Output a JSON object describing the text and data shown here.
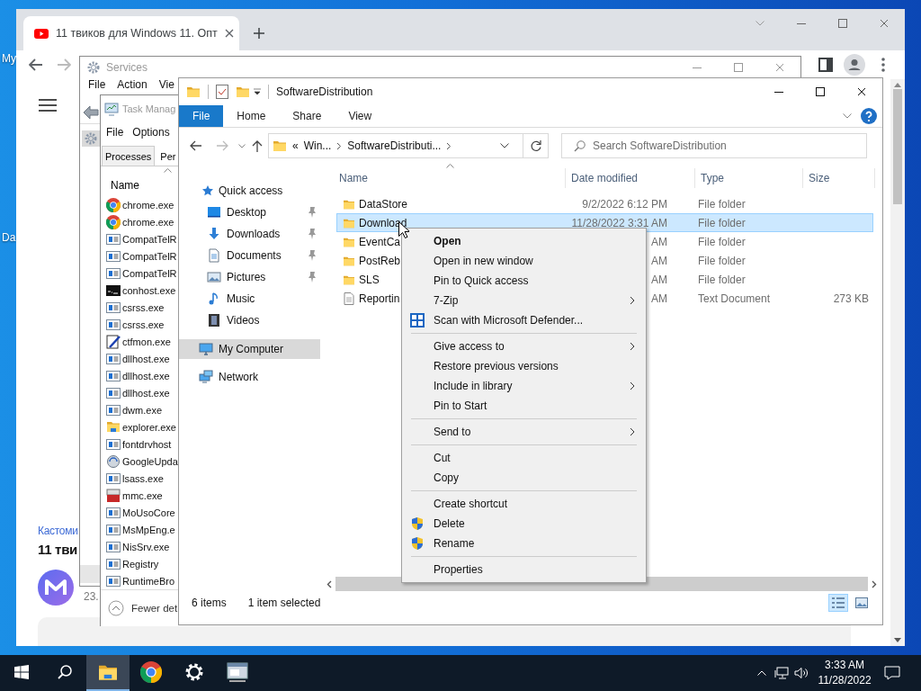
{
  "desktop": {
    "icon_labels": [
      "My",
      "Da"
    ]
  },
  "browser": {
    "tab_title": "11 твиков для Windows 11. Опт",
    "page": {
      "category": "Кастоми",
      "heading": "11 тви",
      "date": "23."
    }
  },
  "services": {
    "title": "Services",
    "menu": [
      "File",
      "Action",
      "Vie"
    ]
  },
  "task_manager": {
    "title": "Task Manag",
    "menu": [
      "File",
      "Options"
    ],
    "tabs": [
      {
        "label": "Processes",
        "selected": true
      },
      {
        "label": "Per",
        "selected": false
      }
    ],
    "column": "Name",
    "processes": [
      {
        "name": "chrome.exe",
        "kind": "chrome"
      },
      {
        "name": "chrome.exe",
        "kind": "chrome"
      },
      {
        "name": "CompatTelR",
        "kind": "app"
      },
      {
        "name": "CompatTelR",
        "kind": "app"
      },
      {
        "name": "CompatTelR",
        "kind": "app"
      },
      {
        "name": "conhost.exe",
        "kind": "console"
      },
      {
        "name": "csrss.exe",
        "kind": "app"
      },
      {
        "name": "csrss.exe",
        "kind": "app"
      },
      {
        "name": "ctfmon.exe",
        "kind": "pen"
      },
      {
        "name": "dllhost.exe",
        "kind": "app"
      },
      {
        "name": "dllhost.exe",
        "kind": "app"
      },
      {
        "name": "dllhost.exe",
        "kind": "app"
      },
      {
        "name": "dwm.exe",
        "kind": "app"
      },
      {
        "name": "explorer.exe",
        "kind": "explorer"
      },
      {
        "name": "fontdrvhost",
        "kind": "app"
      },
      {
        "name": "GoogleUpda",
        "kind": "update"
      },
      {
        "name": "lsass.exe",
        "kind": "app"
      },
      {
        "name": "mmc.exe",
        "kind": "toolbox"
      },
      {
        "name": "MoUsoCore",
        "kind": "app"
      },
      {
        "name": "MsMpEng.e",
        "kind": "app"
      },
      {
        "name": "NisSrv.exe",
        "kind": "app"
      },
      {
        "name": "Registry",
        "kind": "app"
      },
      {
        "name": "RuntimeBro",
        "kind": "app"
      }
    ],
    "footer": "Fewer det"
  },
  "explorer": {
    "title": "SoftwareDistribution",
    "ribbon_tabs": [
      {
        "label": "File",
        "selected": true
      },
      {
        "label": "Home",
        "selected": false
      },
      {
        "label": "Share",
        "selected": false
      },
      {
        "label": "View",
        "selected": false
      }
    ],
    "path_overflow": "«",
    "path": [
      "Win...",
      "SoftwareDistributi..."
    ],
    "search_placeholder": "Search SoftwareDistribution",
    "nav": [
      {
        "label": "Quick access",
        "kind": "star",
        "selected": false,
        "children": [
          {
            "label": "Desktop",
            "kind": "desktop",
            "pinned": true,
            "selected": false
          },
          {
            "label": "Downloads",
            "kind": "downloads",
            "pinned": true,
            "selected": false
          },
          {
            "label": "Documents",
            "kind": "documents",
            "pinned": true,
            "selected": false
          },
          {
            "label": "Pictures",
            "kind": "pictures",
            "pinned": true,
            "selected": false
          },
          {
            "label": "Music",
            "kind": "music",
            "pinned": false,
            "selected": false
          },
          {
            "label": "Videos",
            "kind": "videos",
            "pinned": false,
            "selected": false
          }
        ]
      },
      {
        "label": "My Computer",
        "kind": "computer",
        "selected": true
      },
      {
        "label": "Network",
        "kind": "network",
        "selected": false
      }
    ],
    "columns": [
      "Name",
      "Date modified",
      "Type",
      "Size"
    ],
    "files": [
      {
        "name": "DataStore",
        "date": "9/2/2022 6:12 PM",
        "type": "File folder",
        "kind": "folder",
        "selected": false
      },
      {
        "name": "Download",
        "date": "11/28/2022 3:31 AM",
        "type": "File folder",
        "kind": "folder",
        "selected": true
      },
      {
        "name": "EventCa",
        "date": "AM",
        "type": "File folder",
        "kind": "folder",
        "selected": false
      },
      {
        "name": "PostReb",
        "date": "AM",
        "type": "File folder",
        "kind": "folder",
        "selected": false
      },
      {
        "name": "SLS",
        "date": "AM",
        "type": "File folder",
        "kind": "folder",
        "selected": false
      },
      {
        "name": "Reportin",
        "date": "AM",
        "type": "Text Document",
        "size": "273 KB",
        "kind": "text",
        "selected": false
      }
    ],
    "status": {
      "count": "6 items",
      "selection": "1 item selected"
    }
  },
  "context_menu": {
    "groups": [
      [
        {
          "label": "Open",
          "kind": "plain",
          "default": true,
          "submenu": false
        },
        {
          "label": "Open in new window",
          "kind": "plain",
          "default": false,
          "submenu": false
        },
        {
          "label": "Pin to Quick access",
          "kind": "plain",
          "default": false,
          "submenu": false
        },
        {
          "label": "7-Zip",
          "kind": "plain",
          "default": false,
          "submenu": true
        },
        {
          "label": "Scan with Microsoft Defender...",
          "kind": "defender",
          "default": false,
          "submenu": false
        }
      ],
      [
        {
          "label": "Give access to",
          "kind": "plain",
          "default": false,
          "submenu": true
        },
        {
          "label": "Restore previous versions",
          "kind": "plain",
          "default": false,
          "submenu": false
        },
        {
          "label": "Include in library",
          "kind": "plain",
          "default": false,
          "submenu": true
        },
        {
          "label": "Pin to Start",
          "kind": "plain",
          "default": false,
          "submenu": false
        }
      ],
      [
        {
          "label": "Send to",
          "kind": "plain",
          "default": false,
          "submenu": true
        }
      ],
      [
        {
          "label": "Cut",
          "kind": "plain",
          "default": false,
          "submenu": false
        },
        {
          "label": "Copy",
          "kind": "plain",
          "default": false,
          "submenu": false
        }
      ],
      [
        {
          "label": "Create shortcut",
          "kind": "plain",
          "default": false,
          "submenu": false
        },
        {
          "label": "Delete",
          "kind": "shield",
          "default": false,
          "submenu": false
        },
        {
          "label": "Rename",
          "kind": "shield",
          "default": false,
          "submenu": false
        }
      ],
      [
        {
          "label": "Properties",
          "kind": "plain",
          "default": false,
          "submenu": false
        }
      ]
    ]
  },
  "taskbar": {
    "apps": [
      {
        "kind": "explorer",
        "selected": true
      },
      {
        "kind": "chrome",
        "selected": false
      },
      {
        "kind": "settings",
        "selected": false
      },
      {
        "kind": "console-window",
        "selected": false
      }
    ],
    "time": "3:33 AM",
    "date": "11/28/2022"
  }
}
